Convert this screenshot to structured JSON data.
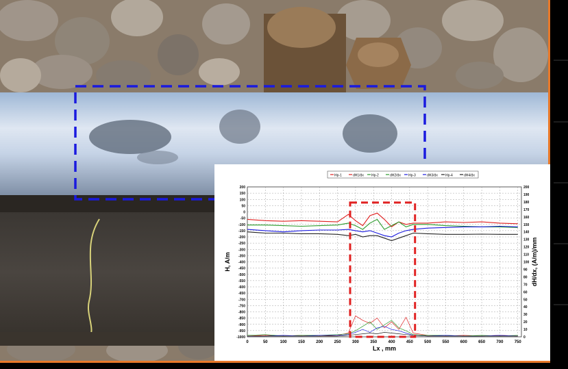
{
  "colors": {
    "photo_frame": "#e8792a",
    "defect_box": "#1a1adf",
    "zone_box": "#e02020",
    "series": [
      "#e02020",
      "#1a1adf",
      "#2a9a2a",
      "#222222"
    ]
  },
  "chart_data": {
    "type": "line",
    "legend": [
      "Hp-1",
      "dH1/dx",
      "Hp-2",
      "dH2/dx",
      "Hp-3",
      "dH3/dx",
      "Hp-4",
      "dH4/dx"
    ],
    "legend_position": "top-center",
    "grid": true,
    "xlabel": "Lx , mm",
    "ylabel": "H, A/m",
    "ylabel_right": "dH/dx, (A/m)/mm",
    "xlim": [
      0,
      760
    ],
    "ylim": [
      -1000,
      200
    ],
    "ylim_right": [
      0,
      200
    ],
    "x_ticks": [
      "0",
      "50",
      "100",
      "150",
      "200",
      "250",
      "300",
      "350",
      "400",
      "450",
      "500",
      "550",
      "600",
      "650",
      "700",
      "750"
    ],
    "y_ticks": [
      "200",
      "150",
      "100",
      "50",
      "0",
      "-50",
      "-100",
      "-150",
      "-200",
      "-250",
      "-300",
      "-350",
      "-400",
      "-450",
      "-500",
      "-550",
      "-600",
      "-650",
      "-700",
      "-750",
      "-800",
      "-850",
      "-900",
      "-950",
      "-1000"
    ],
    "y_ticks_right": [
      "200",
      "190",
      "180",
      "170",
      "160",
      "150",
      "140",
      "130",
      "120",
      "110",
      "100",
      "90",
      "80",
      "70",
      "60",
      "50",
      "40",
      "30",
      "20",
      "10",
      "0"
    ],
    "x": [
      0,
      50,
      100,
      150,
      200,
      250,
      280,
      300,
      320,
      340,
      360,
      380,
      400,
      420,
      440,
      460,
      500,
      550,
      600,
      650,
      700,
      750
    ],
    "series": [
      {
        "name": "Hp-1",
        "axis": "left",
        "values": [
          -60,
          -70,
          -75,
          -70,
          -75,
          -80,
          -20,
          -70,
          -110,
          -30,
          -10,
          -60,
          -120,
          -80,
          -100,
          -90,
          -90,
          -80,
          -85,
          -80,
          -90,
          -95
        ]
      },
      {
        "name": "Hp-2",
        "axis": "left",
        "values": [
          -105,
          -105,
          -110,
          -115,
          -110,
          -105,
          -90,
          -110,
          -140,
          -90,
          -60,
          -140,
          -110,
          -80,
          -120,
          -100,
          -100,
          -110,
          -115,
          -120,
          -120,
          -125
        ]
      },
      {
        "name": "Hp-3",
        "axis": "left",
        "values": [
          -140,
          -150,
          -160,
          -150,
          -145,
          -145,
          -140,
          -150,
          -160,
          -150,
          -170,
          -190,
          -200,
          -170,
          -150,
          -140,
          -130,
          -125,
          -120,
          -120,
          -115,
          -120
        ]
      },
      {
        "name": "Hp-4",
        "axis": "left",
        "values": [
          -160,
          -170,
          -170,
          -175,
          -175,
          -180,
          -190,
          -180,
          -200,
          -190,
          -190,
          -210,
          -230,
          -210,
          -190,
          -170,
          -175,
          -180,
          -180,
          -178,
          -180,
          -180
        ]
      },
      {
        "name": "dH1/dx",
        "axis": "right",
        "values": [
          1,
          2,
          1,
          2,
          1,
          2,
          5,
          28,
          22,
          18,
          25,
          12,
          20,
          10,
          26,
          5,
          2,
          1,
          2,
          1,
          2,
          1
        ]
      },
      {
        "name": "dH2/dx",
        "axis": "right",
        "values": [
          2,
          3,
          1,
          2,
          2,
          3,
          4,
          8,
          14,
          20,
          10,
          16,
          22,
          12,
          8,
          3,
          2,
          2,
          1,
          2,
          1,
          2
        ]
      },
      {
        "name": "dH3/dx",
        "axis": "right",
        "values": [
          1,
          1,
          2,
          1,
          2,
          2,
          3,
          6,
          10,
          6,
          12,
          14,
          10,
          8,
          5,
          2,
          1,
          2,
          1,
          1,
          2,
          1
        ]
      },
      {
        "name": "dH4/dx",
        "axis": "right",
        "values": [
          1,
          1,
          1,
          1,
          1,
          1,
          2,
          3,
          4,
          5,
          4,
          6,
          5,
          4,
          3,
          2,
          1,
          1,
          1,
          1,
          1,
          1
        ]
      }
    ],
    "highlight_range_x": [
      285,
      465
    ]
  }
}
